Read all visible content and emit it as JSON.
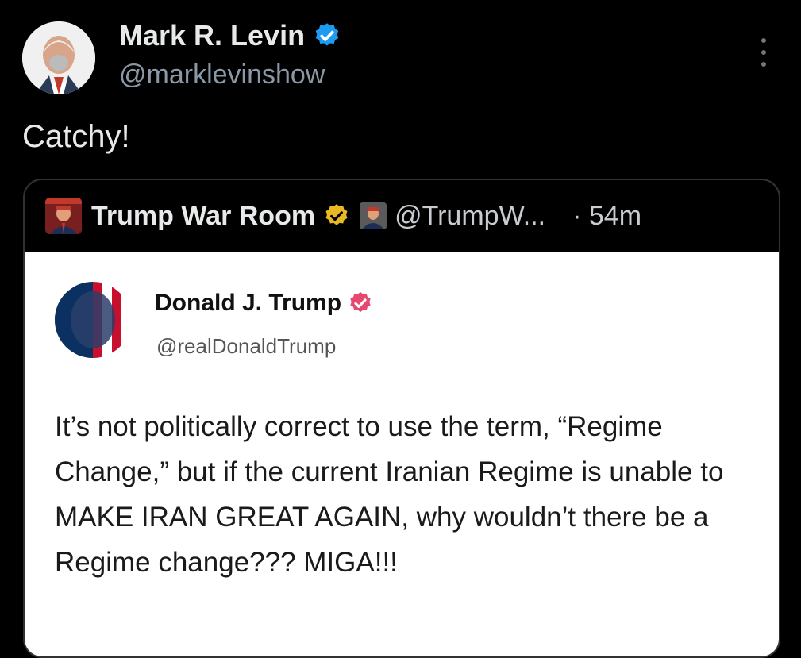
{
  "post": {
    "display_name": "Mark R. Levin",
    "handle": "@marklevinshow",
    "text": "Catchy!",
    "avatar_icon": "profile-photo",
    "verified_color": "#1d9bf0"
  },
  "quote": {
    "display_name": "Trump War Room",
    "handle": "@TrumpW...",
    "time": "· 54m",
    "badge_color": "#e8b923"
  },
  "embedded": {
    "display_name": "Donald J. Trump",
    "handle": "@realDonaldTrump",
    "badge_color": "#e8476f",
    "text": "It’s not politically correct to use the term, “Regime Change,” but if the current Iranian Regime is unable to MAKE IRAN GREAT AGAIN, why wouldn’t there be a Regime change??? MIGA!!!"
  }
}
